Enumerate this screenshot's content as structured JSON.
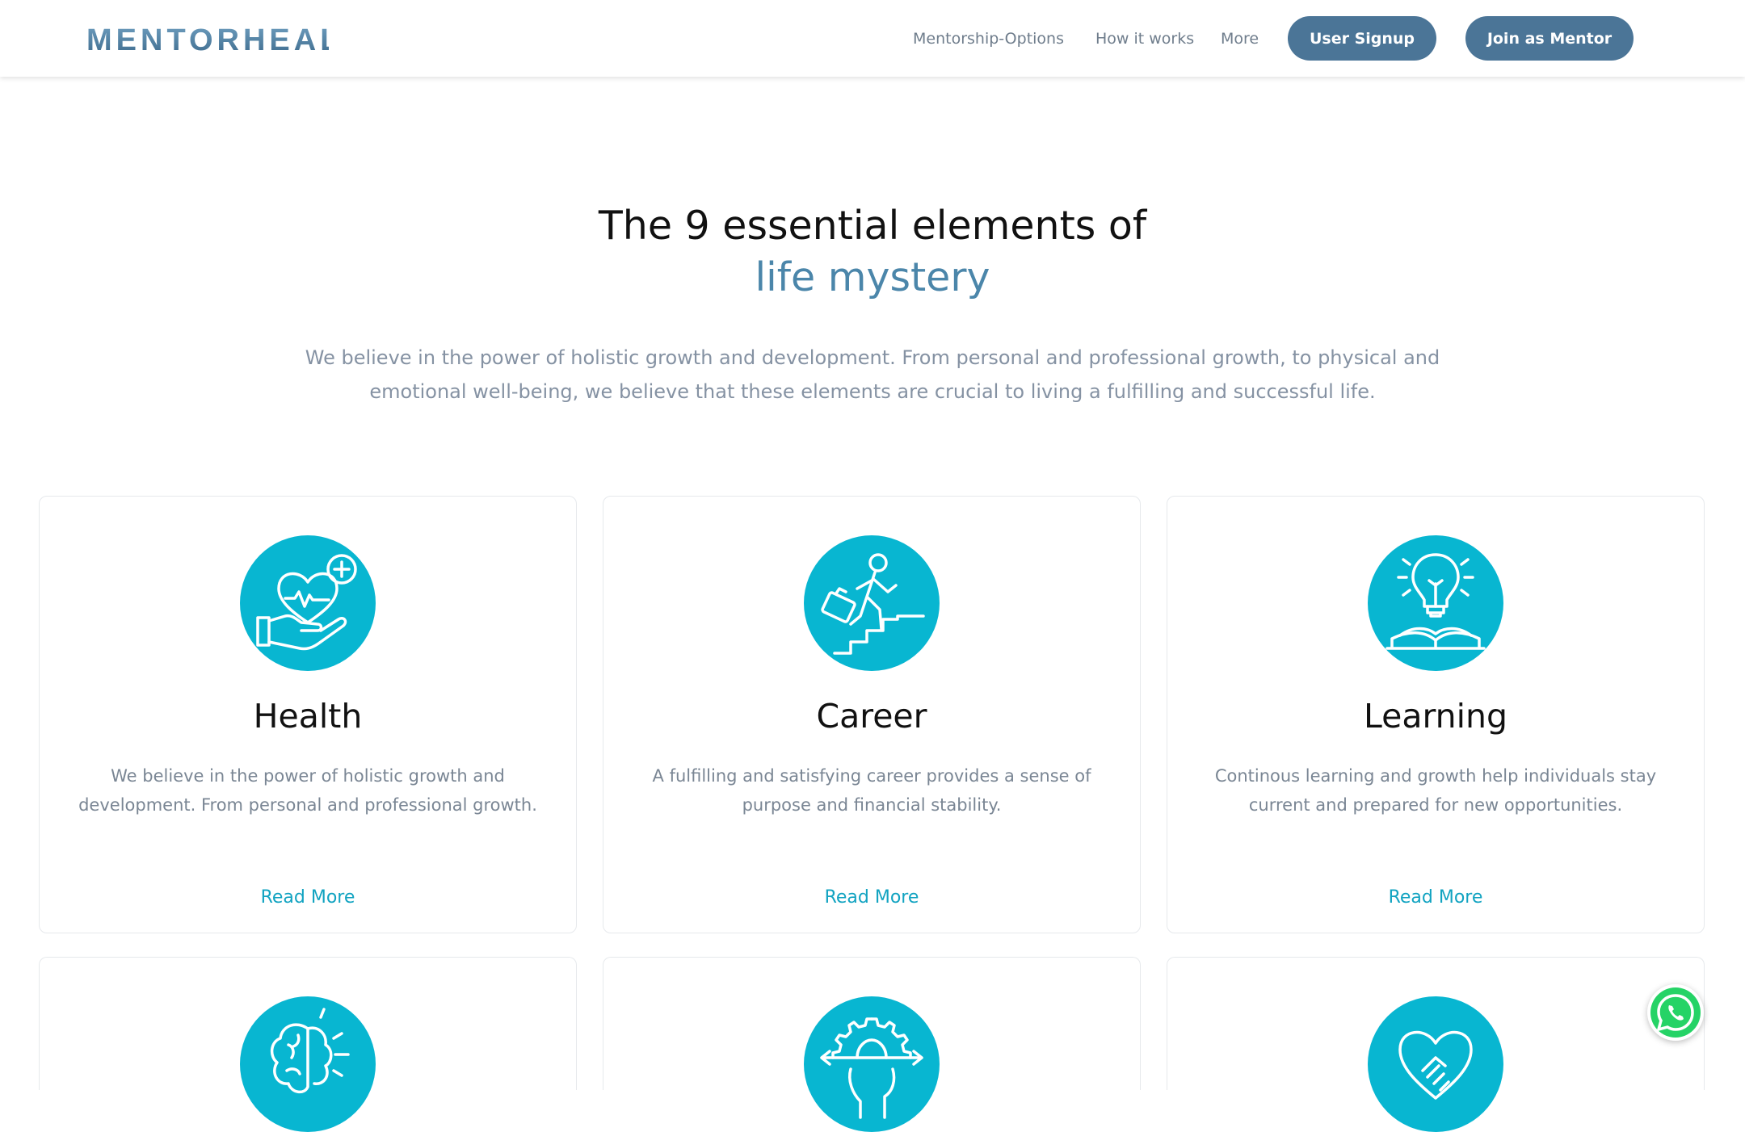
{
  "header": {
    "logo_text": "MENTORHEAL",
    "nav": [
      "Mentorship-Options",
      "How it works",
      "More"
    ],
    "signup_label": "User Signup",
    "mentor_label": "Join as Mentor"
  },
  "hero": {
    "title_line1": "The 9 essential elements of",
    "title_line2": "life mystery",
    "description": "We believe in the power of holistic growth and development. From personal and professional growth, to physical and emotional well-being, we believe that these elements are crucial to living a fulfilling and successful life."
  },
  "cards": [
    {
      "icon": "heart-hand-icon",
      "title": "Health",
      "description": "We believe in the power of holistic growth and development. From personal and professional growth.",
      "link": "Read More"
    },
    {
      "icon": "career-stairs-icon",
      "title": "Career",
      "description": "A fulfilling and satisfying career provides a sense of purpose and financial stability.",
      "link": "Read More"
    },
    {
      "icon": "lightbulb-book-icon",
      "title": "Learning",
      "description": "Continous learning and growth help individuals stay current and prepared for new opportunities.",
      "link": "Read More"
    }
  ],
  "more_card_icons": [
    "brain-icon",
    "gear-head-icon",
    "handshake-heart-icon"
  ],
  "colors": {
    "accent": "#08b6d1",
    "button": "#4b7597",
    "link": "#11a3c1",
    "title_accent": "#4b86aa"
  }
}
